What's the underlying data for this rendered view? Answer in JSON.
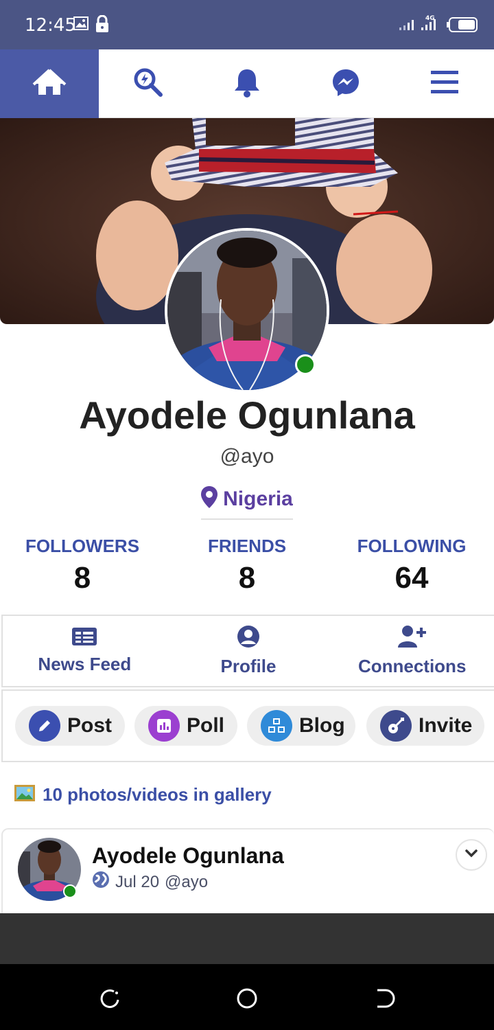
{
  "status_bar": {
    "time": "12:45",
    "network_label": "4G"
  },
  "nav": {
    "items": [
      "home-icon",
      "search-icon",
      "bell-icon",
      "messenger-icon",
      "menu-icon"
    ],
    "active_index": 0,
    "active_color": "#4b5aa6"
  },
  "profile": {
    "name": "Ayodele Ogunlana",
    "handle": "@ayo",
    "location": "Nigeria",
    "online": true
  },
  "stats": [
    {
      "label": "FOLLOWERS",
      "value": "8"
    },
    {
      "label": "FRIENDS",
      "value": "8"
    },
    {
      "label": "FOLLOWING",
      "value": "64"
    }
  ],
  "tabs": [
    {
      "label": "News Feed",
      "icon": "news-feed-icon"
    },
    {
      "label": "Profile",
      "icon": "user-circle-icon"
    },
    {
      "label": "Connections",
      "icon": "user-plus-icon"
    }
  ],
  "actions": [
    {
      "label": "Post",
      "icon": "pencil-icon",
      "color": "#3b4fb0"
    },
    {
      "label": "Poll",
      "icon": "chart-icon",
      "color": "#9b3fd0"
    },
    {
      "label": "Blog",
      "icon": "cubes-icon",
      "color": "#2f8ad8"
    },
    {
      "label": "Invite",
      "icon": "guitar-icon",
      "color": "#3e4a8c"
    }
  ],
  "gallery": {
    "text": "10 photos/videos in gallery"
  },
  "post": {
    "author": "Ayodele Ogunlana",
    "date": "Jul 20",
    "handle": "@ayo"
  },
  "colors": {
    "status_bar": "#4b5585",
    "accent": "#3b4fa6",
    "location": "#5b3fa0",
    "online": "#1a8f1a"
  }
}
